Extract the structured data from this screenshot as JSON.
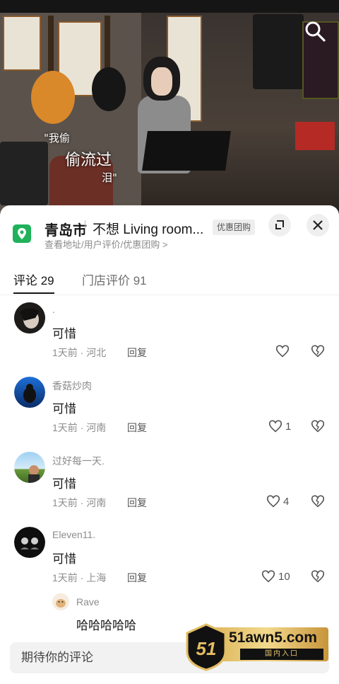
{
  "video": {
    "subtitle_1": "\"我偷",
    "subtitle_2": "偷流过",
    "subtitle_3": "泪\""
  },
  "shop": {
    "city": "青岛市",
    "name": "不想 Living room...",
    "badge": "优惠团购",
    "subline": "查看地址/用户评价/优惠团购 >"
  },
  "tabs": [
    {
      "label": "评论 29"
    },
    {
      "label": "门店评价 91"
    }
  ],
  "comments": [
    {
      "user": ".",
      "text": "可惜",
      "meta": "1天前 · 河北",
      "reply": "回复",
      "likes": ""
    },
    {
      "user": "香菇炒肉",
      "text": "可惜",
      "meta": "1天前 · 河南",
      "reply": "回复",
      "likes": "1"
    },
    {
      "user": "过好每一天.",
      "text": "可惜",
      "meta": "1天前 · 河南",
      "reply": "回复",
      "likes": "4"
    },
    {
      "user": "Eleven11.",
      "text": "可惜",
      "meta": "1天前 · 上海",
      "reply": "回复",
      "likes": "10"
    }
  ],
  "sub_reply": {
    "user": "Rave",
    "text": "哈哈哈哈哈"
  },
  "input": {
    "placeholder": "期待你的评论"
  },
  "watermark": {
    "domain": "51awn5.com",
    "sub": "国内入口",
    "logo_text": "51"
  },
  "colors": {
    "location_green": "#1fb25a",
    "gold": "#e2bd63"
  }
}
